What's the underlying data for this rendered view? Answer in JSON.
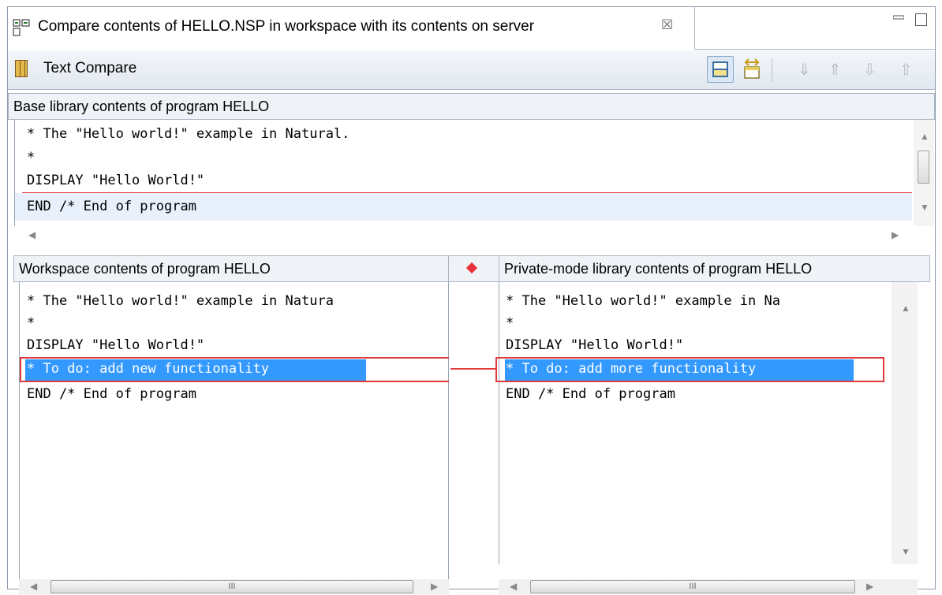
{
  "tab": {
    "title": "Compare contents of HELLO.NSP in workspace with its contents on server",
    "close_glyph": "☒"
  },
  "compare": {
    "title": "Text Compare",
    "toolbar": [
      {
        "name": "layout-toggle-icon",
        "glyph": ""
      },
      {
        "name": "swap-sides-icon",
        "glyph": "⇔"
      },
      {
        "name": "next-difference-icon",
        "glyph": "⇓"
      },
      {
        "name": "previous-difference-icon",
        "glyph": "⇑"
      },
      {
        "name": "next-change-icon",
        "glyph": "⇩"
      },
      {
        "name": "previous-change-icon",
        "glyph": "⇧"
      }
    ]
  },
  "base": {
    "title": "Base library contents of program HELLO",
    "lines": [
      "* The \"Hello world!\" example in Natural.",
      "*",
      "DISPLAY \"Hello World!\"",
      "END /* End of program"
    ]
  },
  "workspace": {
    "title": "Workspace contents of program HELLO",
    "lines": [
      "* The \"Hello world!\" example in Natura",
      "*",
      "DISPLAY \"Hello World!\"",
      "* To do: add new functionality",
      "END /* End of program"
    ]
  },
  "private": {
    "title": "Private-mode library contents of program HELLO",
    "lines": [
      "* The \"Hello world!\" example in Na",
      "*",
      "DISPLAY \"Hello World!\"",
      "* To do: add more functionality",
      "END /* End of program"
    ]
  },
  "scrollbar": {
    "thumb_glyph": "III",
    "left_arrow": "◀",
    "right_arrow": "▶",
    "up_arrow": "▲",
    "down_arrow": "▼"
  },
  "colors": {
    "selection": "#3399ff",
    "difference": "#e03a3a"
  }
}
